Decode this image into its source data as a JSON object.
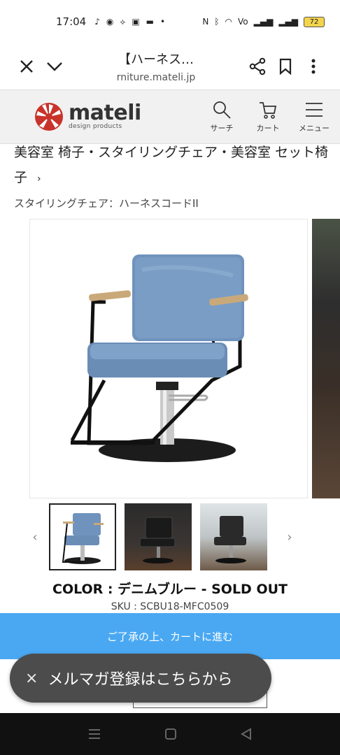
{
  "status": {
    "time": "17:04",
    "battery": "72"
  },
  "browser": {
    "title": "【ハーネス…",
    "url": "rniture.mateli.jp"
  },
  "site": {
    "logo_name": "mateli",
    "logo_sub": "design products",
    "search_label": "サーチ",
    "cart_label": "カート",
    "menu_label": "メニュー"
  },
  "breadcrumb": {
    "text": "美容室 椅子・スタイリングチェア・美容室 セット椅子",
    "arrow": "›"
  },
  "product": {
    "subtitle": "スタイリングチェア：ハーネスコードII",
    "color_line": "COLOR : デニムブルー - SOLD OUT",
    "sku": "SKU : SCBU18-MFC0509",
    "thumb_prev": "‹",
    "thumb_next": "›"
  },
  "cart_bar": {
    "label": "ご了承の上、カートに進む"
  },
  "newsletter": {
    "close": "×",
    "label": "メルマガ登録はこちらから"
  },
  "colors": {
    "accent": "#4aa8f2",
    "brand_red": "#c8332b",
    "chair_blue": "#6f93bd"
  }
}
